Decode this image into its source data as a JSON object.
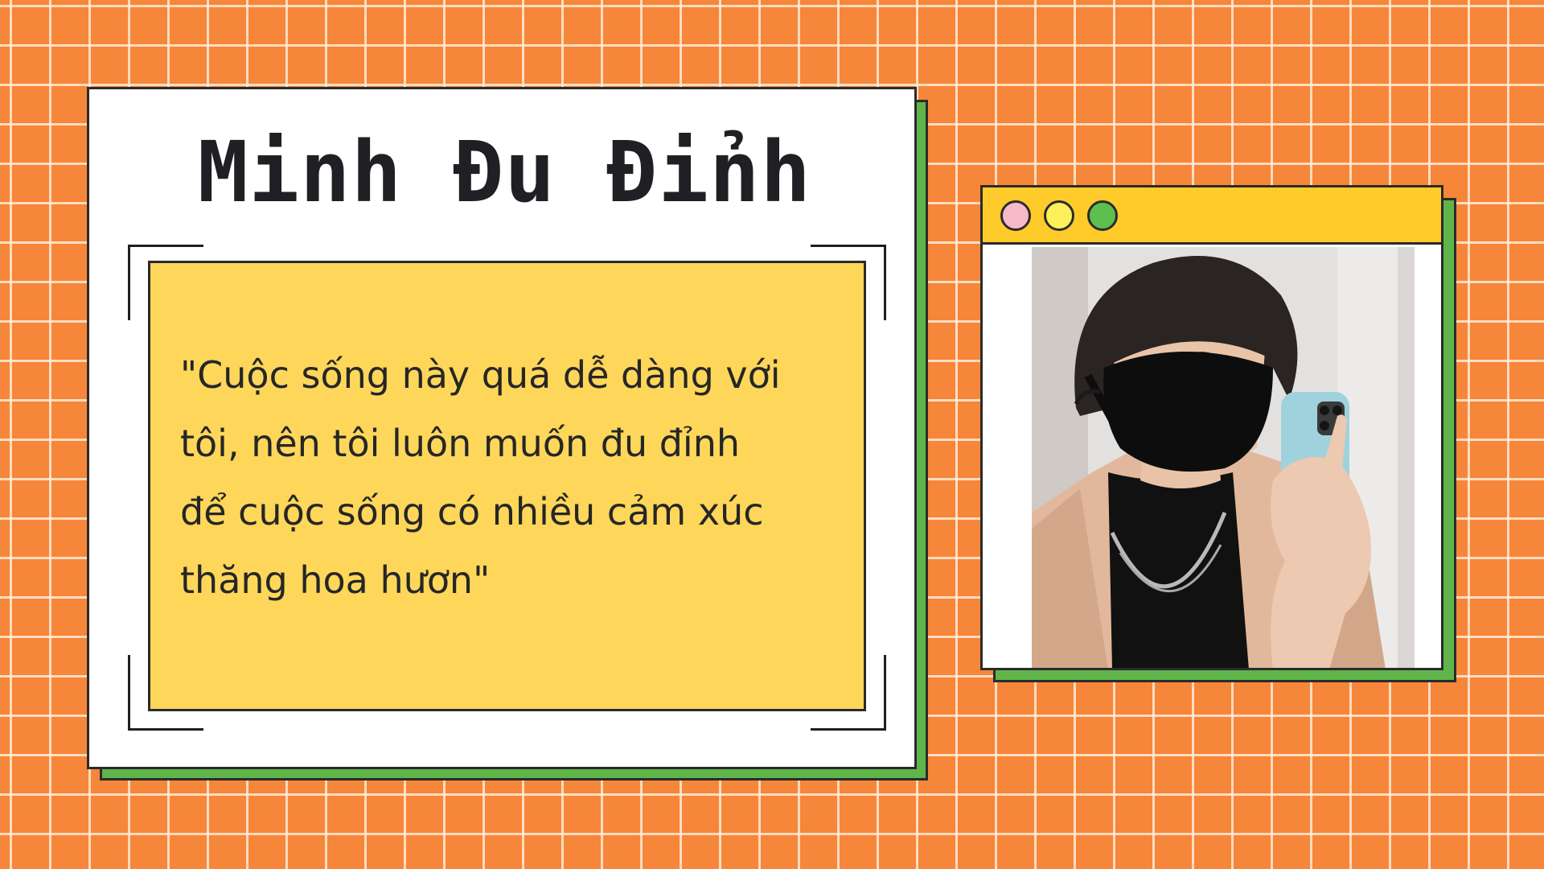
{
  "card": {
    "title": "Minh Đu Đỉnh",
    "quote": "\"Cuộc sống này quá dễ dàng với\ntôi, nên tôi luôn muốn đu đỉnh\nđể cuộc sống có nhiều cảm xúc\nthăng hoa hươn\""
  },
  "window": {
    "dots": [
      "pink",
      "yellow",
      "green"
    ]
  },
  "colors": {
    "background": "#f5863a",
    "shadow_green": "#5fb549",
    "quote_yellow": "#fed75a",
    "titlebar_yellow": "#ffcb2b"
  }
}
